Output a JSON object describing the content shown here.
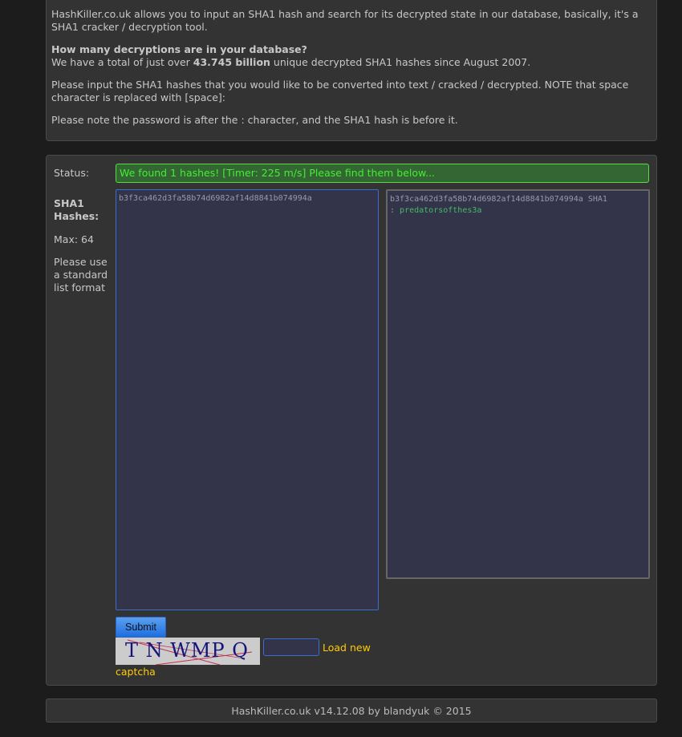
{
  "intro": {
    "p1": "HashKiller.co.uk allows you to input an SHA1 hash and search for its decrypted state in our database, basically, it's a SHA1 cracker / decryption tool.",
    "question": "How many decryptions are in your database?",
    "total_prefix": "We have a total of just over ",
    "total_value": "43.745 billion",
    "total_suffix": " unique decrypted SHA1 hashes since August 2007.",
    "p3": "Please input the SHA1 hashes that you would like to be converted into text / cracked / decrypted. NOTE that space character is replaced with [space]:",
    "p4": "Please note the password is after the : character, and the SHA1 hash is before it."
  },
  "form": {
    "status_label": "Status:",
    "status_text": "We found 1 hashes! [Timer: 225 m/s] Please find them below...",
    "hashes_label": "SHA1 Hashes:",
    "max_label": "Max: 64",
    "format_hint": "Please use a standard list format",
    "input_value": "b3f3ca462d3fa58b74d6982af14d8841b074994a",
    "result_hash": "b3f3ca462d3fa58b74d6982af14d8841b074994a SHA1",
    "result_sep": ": ",
    "result_password": "predatorsofthes3a",
    "submit_label": "Submit",
    "captcha_text": "T N WMP Q",
    "captcha_input": "",
    "load_new_label": "Load new",
    "captcha_label": "captcha"
  },
  "footer": {
    "text": "HashKiller.co.uk v14.12.08 by blandyuk © 2015"
  }
}
